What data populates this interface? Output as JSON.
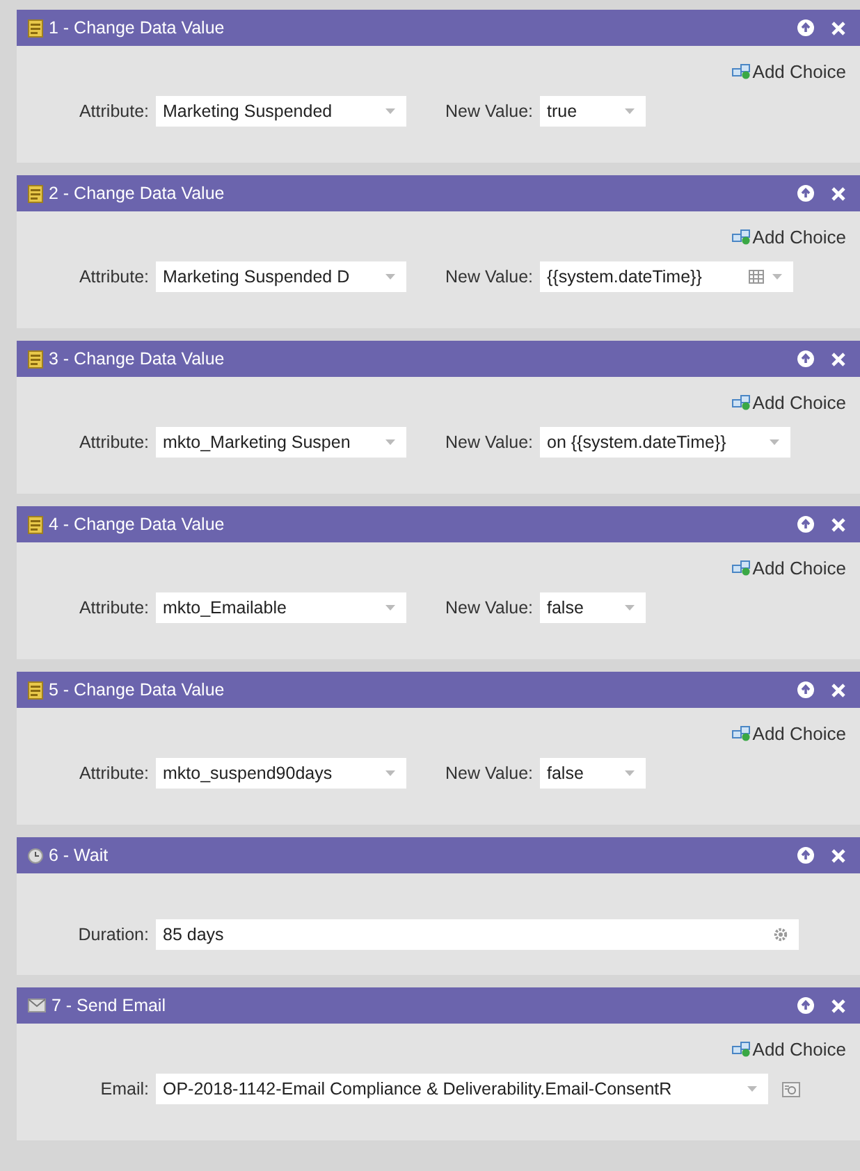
{
  "steps": [
    {
      "kind": "change_data_value",
      "title": "1 - Change Data Value",
      "add_choice": "Add Choice",
      "fields": [
        {
          "kind": "select-wide",
          "label": "Attribute:",
          "value": "Marketing Suspended"
        },
        {
          "kind": "select-narrow",
          "label": "New Value:",
          "value": "true"
        }
      ]
    },
    {
      "kind": "change_data_value",
      "title": "2 - Change Data Value",
      "add_choice": "Add Choice",
      "fields": [
        {
          "kind": "select-wide",
          "label": "Attribute:",
          "value": "Marketing Suspended D"
        },
        {
          "kind": "date",
          "label": "New Value:",
          "value": "{{system.dateTime}}"
        }
      ]
    },
    {
      "kind": "change_data_value",
      "title": "3 - Change Data Value",
      "add_choice": "Add Choice",
      "fields": [
        {
          "kind": "select-wide",
          "label": "Attribute:",
          "value": "mkto_Marketing Suspen"
        },
        {
          "kind": "select-wide",
          "label": "New Value:",
          "value": "on {{system.dateTime}}"
        }
      ]
    },
    {
      "kind": "change_data_value",
      "title": "4 - Change Data Value",
      "add_choice": "Add Choice",
      "fields": [
        {
          "kind": "select-wide",
          "label": "Attribute:",
          "value": "mkto_Emailable"
        },
        {
          "kind": "select-narrow",
          "label": "New Value:",
          "value": "false"
        }
      ]
    },
    {
      "kind": "change_data_value",
      "title": "5 - Change Data Value",
      "add_choice": "Add Choice",
      "fields": [
        {
          "kind": "select-wide",
          "label": "Attribute:",
          "value": "mkto_suspend90days"
        },
        {
          "kind": "select-narrow",
          "label": "New Value:",
          "value": "false"
        }
      ]
    },
    {
      "kind": "wait",
      "title": "6 - Wait",
      "fields": [
        {
          "kind": "duration",
          "label": "Duration:",
          "value": "85 days"
        }
      ]
    },
    {
      "kind": "send_email",
      "title": "7 - Send Email",
      "add_choice": "Add Choice",
      "fields": [
        {
          "kind": "email",
          "label": "Email:",
          "value": "OP-2018-1142-Email Compliance & Deliverability.Email-ConsentR"
        }
      ]
    }
  ]
}
